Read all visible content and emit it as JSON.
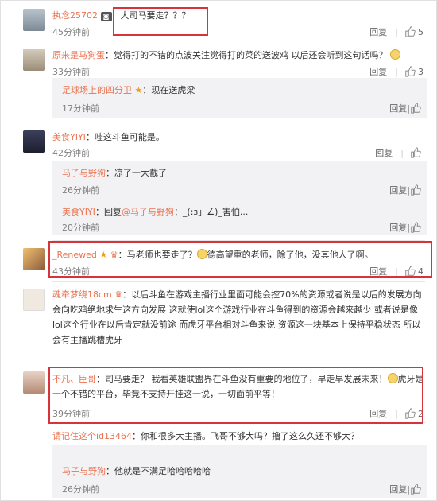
{
  "comments": [
    {
      "user": "执念25702",
      "sep": "：",
      "text": "大司马要走？？？",
      "time": "45分钟前",
      "reply": "回复",
      "likes": "5"
    },
    {
      "user": "原来是马狗蛋",
      "sep": "：",
      "text": "觉得打的不错的点波关注觉得打的菜的送波鸡  以后还会听到这句话吗？",
      "time": "33分钟前",
      "reply": "回复",
      "likes": "3",
      "subs": [
        {
          "user": "足球场上的四分卫",
          "sep": "：",
          "text": "现在送虎梁",
          "time": "17分钟前",
          "reply": "回复",
          "likes": ""
        }
      ]
    },
    {
      "user": "美食YIYI",
      "sep": "：",
      "text": "哇这斗鱼可能是。",
      "time": "42分钟前",
      "reply": "回复",
      "likes": "",
      "subs": [
        {
          "user": "马子与野狗",
          "sep": "：",
          "text": "凉了一大截了",
          "time": "26分钟前",
          "reply": "回复",
          "likes": ""
        },
        {
          "user": "美食YIYI",
          "sep": "：",
          "text_prefix": "回复",
          "mention": "@马子与野狗",
          "text": "：_(:з」∠)_害怕...",
          "time": "20分钟前",
          "reply": "回复",
          "likes": ""
        }
      ]
    },
    {
      "user": "_Renewed",
      "sep": "：",
      "text": "马老师也要走了？",
      "text2": "德高望重的老师，除了他，没其他人了啊。",
      "time": "43分钟前",
      "reply": "回复",
      "likes": "4"
    },
    {
      "user": "魂牵梦绕18cm",
      "sep": "：",
      "text": "以后斗鱼在游戏主播行业里面可能会控70%的资源或者说是以后的发展方向会向吃鸡绝地求生这方向发展 这就使lol这个游戏行业在斗鱼得到的资源会越来越少  或者说是像lol这个行业在以后肯定就没前途  而虎牙平台相对斗鱼来说  资源这一块基本上保持平稳状态  所以会有主播跳槽虎牙",
      "time": "",
      "reply": "",
      "likes": ""
    },
    {
      "user": "不凡、臣哥",
      "sep": "：",
      "text": "司马要走？  我看英雄联盟界在斗鱼没有重要的地位了，早走早发展未来！",
      "text2": "虎牙是一个不错的平台，毕竟不支持开挂这一说，一切面前平等！",
      "time": "39分钟前",
      "reply": "回复",
      "likes": "2"
    },
    {
      "user": "请记住这个id13464",
      "sep": "：",
      "text": "你和很多大主播。飞哥不够大吗？撸了这么久还不够大？",
      "time": "",
      "reply": "",
      "likes": "",
      "subs": [
        {
          "user": "马子与野狗",
          "sep": "：",
          "text": "他就是不满足哈哈哈哈哈",
          "time": "26分钟前",
          "reply": "回复",
          "likes": ""
        }
      ]
    }
  ],
  "colors": {
    "username": "#eb7350",
    "highlight_border": "#d9323a",
    "subbox_bg": "#f2f2f5"
  }
}
